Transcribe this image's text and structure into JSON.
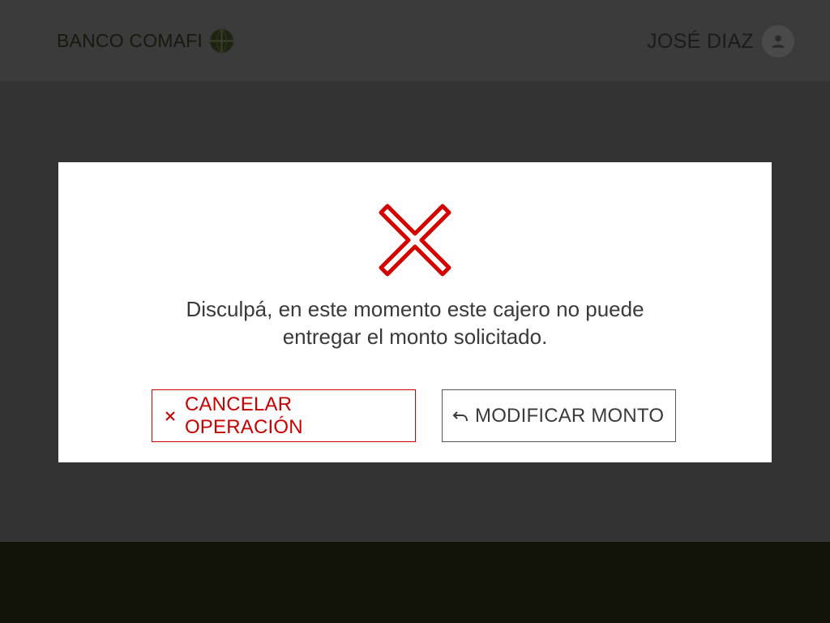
{
  "header": {
    "bank_name": "BANCO COMAFI",
    "logo_icon": "globe-logo-icon",
    "user_name": "JOSÉ DIAZ",
    "avatar_icon": "person-icon"
  },
  "modal": {
    "status_icon": "error-x-icon",
    "message_line1": "Disculpá, en este momento este cajero no puede",
    "message_line2": "entregar el monto solicitado.",
    "cancel_button": {
      "icon": "close-icon",
      "label": "CANCELAR OPERACIÓN"
    },
    "modify_button": {
      "icon": "undo-icon",
      "label": "MODIFICAR MONTO"
    }
  },
  "colors": {
    "overlay_bg": "#333333",
    "header_bg": "#3b3b3b",
    "footer_bg": "#131409",
    "modal_bg": "#ffffff",
    "error_red": "#c80000",
    "text_dark": "#3a3a3a"
  }
}
